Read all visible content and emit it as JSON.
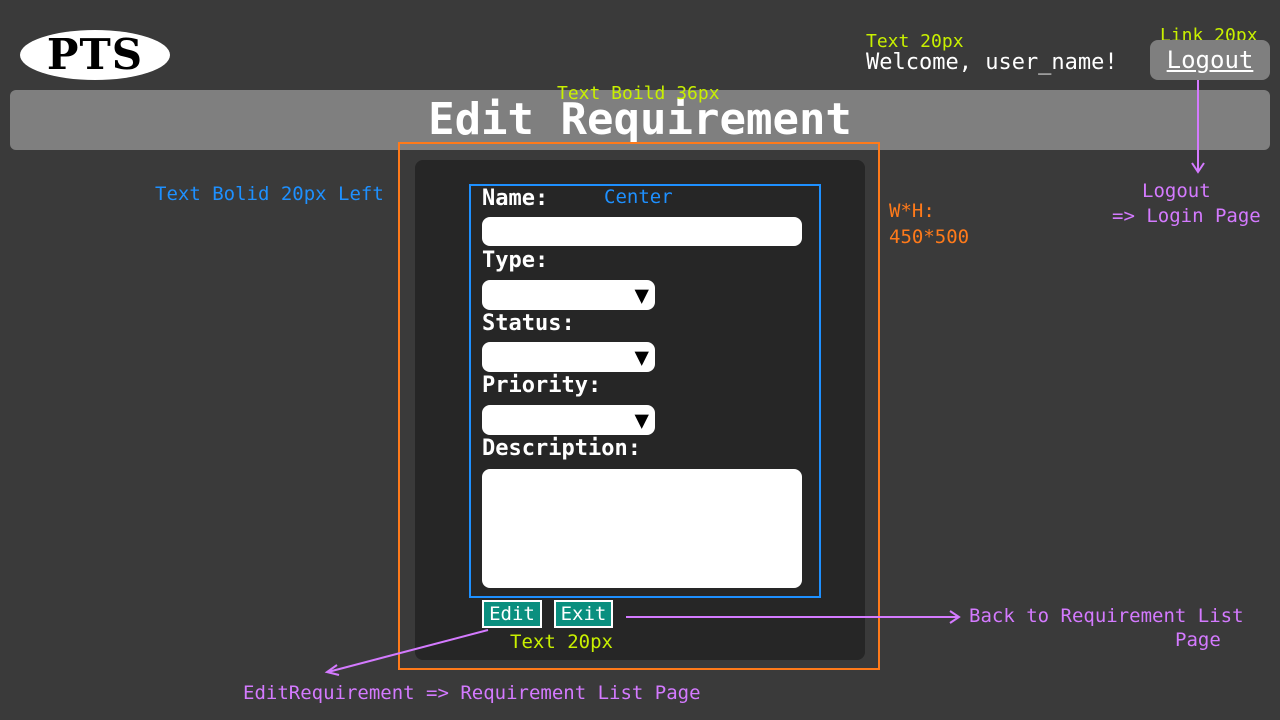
{
  "logo": {
    "text": "PTS"
  },
  "header": {
    "welcome": "Welcome, user_name!",
    "logout_label": "Logout"
  },
  "page": {
    "title": "Edit Requirement"
  },
  "form": {
    "name_label": "Name:",
    "type_label": "Type:",
    "status_label": "Status:",
    "priority_label": "Priority:",
    "description_label": "Description:",
    "name_value": "",
    "description_value": "",
    "dropdown_arrow": "▼",
    "edit_label": "Edit",
    "exit_label": "Exit"
  },
  "annotations": {
    "text20_top": "Text 20px",
    "link20": "Link 20px",
    "title_bold": "Text Boild 36px",
    "text_bold_left": "Text Bolid 20px Left",
    "center": "Center",
    "wh_label": "W*H:",
    "wh_value": "450*500",
    "logout_note_line1": "Logout",
    "logout_note_line2": "=> Login Page",
    "exit_note_line1": "Back to Requirement List",
    "exit_note_line2": "Page",
    "buttons_text": "Text 20px",
    "edit_note": "EditRequirement => Requirement List Page"
  },
  "colors": {
    "background": "#3a3a3a",
    "header_bar": "#7f7f7f",
    "panel": "#262626",
    "button": "#0a8f7f",
    "annotation_green": "#c8f000",
    "annotation_blue": "#1e90ff",
    "annotation_orange": "#ff7a1a",
    "annotation_purple": "#d47aff"
  }
}
